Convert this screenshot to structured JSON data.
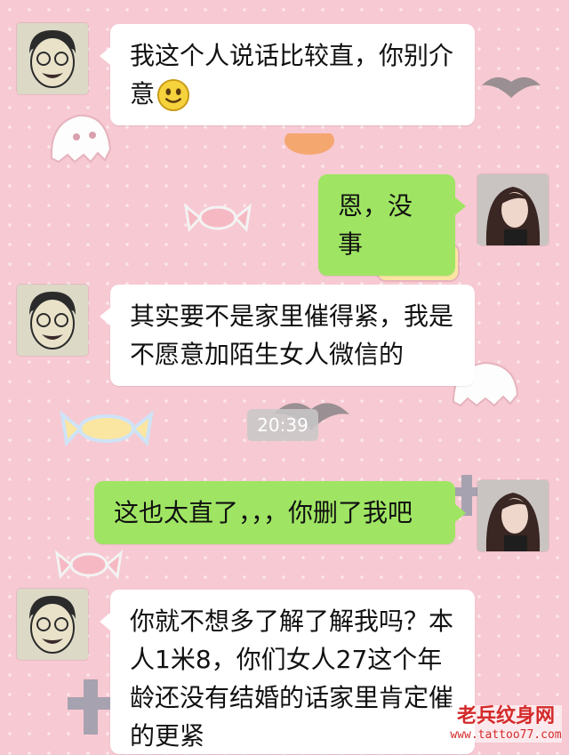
{
  "messages": [
    {
      "side": "left",
      "text": "我这个人说话比较直，你别介意",
      "emoji": "smile-emoji"
    },
    {
      "side": "right",
      "text": "恩，没事"
    },
    {
      "side": "left",
      "text": "其实要不是家里催得紧，我是不愿意加陌生女人微信的"
    },
    {
      "side": "right",
      "text": "这也太直了，，，你删了我吧"
    },
    {
      "side": "left",
      "text": "你就不想多了解了解我吗？本人1米8，你们女人27这个年龄还没有结婚的话家里肯定催的更紧"
    }
  ],
  "timestamp": "20:39",
  "watermark": {
    "title": "老兵纹身网",
    "url": "www.tattoo77.com"
  },
  "colors": {
    "background": "#f7c9d2",
    "bubble_left": "#ffffff",
    "bubble_right": "#9fe563",
    "timestamp_bg": "#c8c8c8",
    "watermark": "#d42a2a"
  }
}
